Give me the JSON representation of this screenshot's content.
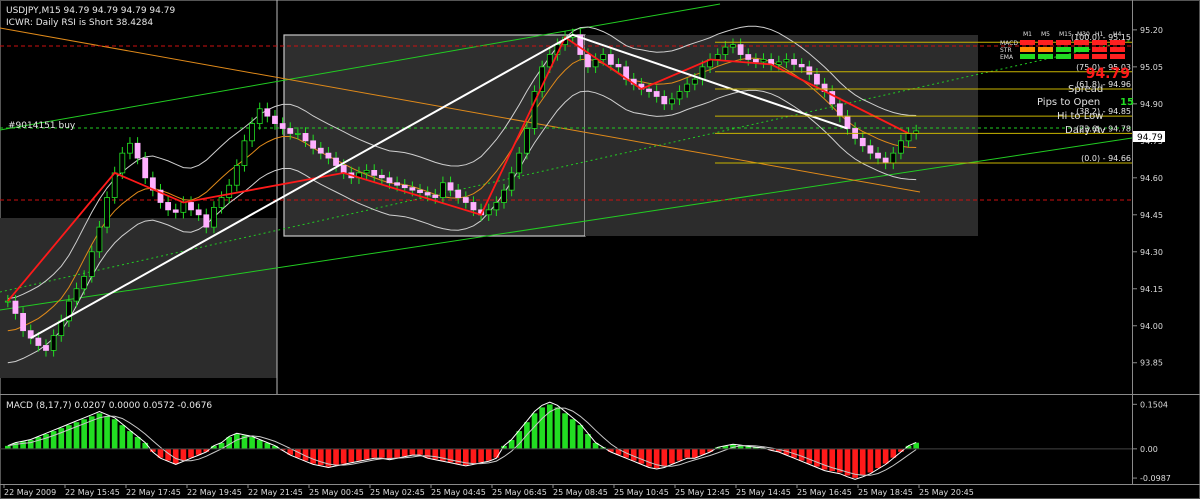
{
  "header": {
    "symbol_line": "USDJPY,M15  94.79 94.79 94.79 94.79",
    "rsi_line": "ICWR: Daily RSI is Short 38.4284",
    "order_label": "#9014151 buy"
  },
  "chart_data": [
    {
      "type": "candlestick",
      "title": "USDJPY,M15",
      "ylim": [
        93.78,
        95.24
      ],
      "y_ticks": [
        "95.20",
        "95.05",
        "94.90",
        "94.75",
        "94.60",
        "94.45",
        "94.30",
        "94.15",
        "94.00",
        "93.85"
      ],
      "y_tick_values": [
        95.2,
        95.05,
        94.9,
        94.75,
        94.6,
        94.45,
        94.3,
        94.15,
        94.0,
        93.85
      ],
      "x_ticks": [
        "22 May 2009",
        "22 May 15:45",
        "22 May 17:45",
        "22 May 19:45",
        "22 May 21:45",
        "25 May 00:45",
        "25 May 02:45",
        "25 May 04:45",
        "25 May 06:45",
        "25 May 08:45",
        "25 May 10:45",
        "25 May 12:45",
        "25 May 14:45",
        "25 May 16:45",
        "25 May 18:45",
        "25 May 20:45"
      ],
      "current_price": "94.79",
      "closes": [
        94.1,
        94.05,
        93.98,
        93.95,
        93.92,
        93.9,
        93.96,
        94.02,
        94.1,
        94.15,
        94.2,
        94.3,
        94.4,
        94.52,
        94.62,
        94.7,
        94.74,
        94.68,
        94.6,
        94.55,
        94.5,
        94.47,
        94.46,
        94.5,
        94.47,
        94.45,
        94.4,
        94.48,
        94.52,
        94.57,
        94.65,
        94.75,
        94.82,
        94.88,
        94.85,
        94.82,
        94.8,
        94.78,
        94.78,
        94.75,
        94.72,
        94.7,
        94.68,
        94.65,
        94.62,
        94.6,
        94.62,
        94.63,
        94.61,
        94.6,
        94.58,
        94.57,
        94.56,
        94.55,
        94.54,
        94.53,
        94.52,
        94.58,
        94.55,
        94.52,
        94.5,
        94.47,
        94.45,
        94.47,
        94.5,
        94.55,
        94.62,
        94.7,
        94.8,
        94.95,
        95.05,
        95.1,
        95.14,
        95.17,
        95.18,
        95.1,
        95.05,
        95.08,
        95.1,
        95.06,
        95.05,
        95.0,
        94.98,
        94.96,
        94.95,
        94.93,
        94.9,
        94.92,
        94.95,
        94.98,
        95.0,
        95.05,
        95.08,
        95.1,
        95.13,
        95.14,
        95.1,
        95.08,
        95.07,
        95.08,
        95.06,
        95.07,
        95.08,
        95.06,
        95.05,
        95.02,
        94.98,
        94.95,
        94.9,
        94.85,
        94.8,
        94.76,
        94.73,
        94.7,
        94.68,
        94.66,
        94.7,
        94.75,
        94.78,
        94.79
      ],
      "fib_levels": [
        {
          "label": "(100.0) - 95.15",
          "value": 95.15
        },
        {
          "label": "(75.0) - 95.03",
          "value": 95.03
        },
        {
          "label": "(61.8) - 94.96",
          "value": 94.96
        },
        {
          "label": "(38.2) - 94.85",
          "value": 94.85
        },
        {
          "label": "(23.6) - 94.78",
          "value": 94.78
        },
        {
          "label": "(0.0) - 94.66",
          "value": 94.66
        }
      ],
      "info_box": {
        "big_number": "94.79",
        "spread_label": "Spread",
        "pips_label": "Pips to Open",
        "pips_value": "15",
        "hilo_label": "Hi to Low",
        "daily_label": "Daily Av"
      },
      "signal_panel": {
        "timeframes": [
          "M1",
          "M5",
          "M15",
          "M30",
          "H1",
          "H4"
        ],
        "rows": [
          "MACD",
          "STR",
          "EMA"
        ],
        "colors": [
          [
            "#ff2020",
            "#ff2020",
            "#ff2020",
            "#ff2020",
            "#ff2020",
            "#ff2020"
          ],
          [
            "#ff8c00",
            "#ff8c00",
            "#22dd22",
            "#22dd22",
            "#ff2020",
            "#ff2020"
          ],
          [
            "#22dd22",
            "#22dd22",
            "#22dd22",
            "#ff2020",
            "#ff2020",
            "#ff2020"
          ]
        ]
      }
    },
    {
      "type": "bar",
      "title": "MACD (8,17,7) 0.0207 0.0000 0.0572 -0.0676",
      "ylim": [
        -0.112,
        0.165
      ],
      "y_ticks": [
        "0.1504",
        "0.00",
        "-0.0987"
      ],
      "y_tick_values": [
        0.1504,
        0.0,
        -0.0987
      ],
      "values": [
        0.01,
        0.02,
        0.025,
        0.03,
        0.04,
        0.05,
        0.06,
        0.07,
        0.08,
        0.09,
        0.1,
        0.11,
        0.12,
        0.11,
        0.1,
        0.08,
        0.06,
        0.04,
        0.02,
        -0.01,
        -0.03,
        -0.04,
        -0.05,
        -0.04,
        -0.03,
        -0.02,
        -0.01,
        0.01,
        0.02,
        0.04,
        0.05,
        0.045,
        0.04,
        0.03,
        0.02,
        0.01,
        -0.005,
        -0.02,
        -0.03,
        -0.04,
        -0.05,
        -0.055,
        -0.06,
        -0.055,
        -0.05,
        -0.045,
        -0.04,
        -0.035,
        -0.03,
        -0.03,
        -0.035,
        -0.03,
        -0.025,
        -0.02,
        -0.02,
        -0.03,
        -0.035,
        -0.04,
        -0.045,
        -0.05,
        -0.055,
        -0.05,
        -0.045,
        -0.04,
        -0.03,
        0.01,
        0.03,
        0.06,
        0.09,
        0.12,
        0.14,
        0.15,
        0.14,
        0.12,
        0.1,
        0.08,
        0.05,
        0.02,
        0.005,
        -0.01,
        -0.02,
        -0.03,
        -0.04,
        -0.05,
        -0.06,
        -0.065,
        -0.06,
        -0.05,
        -0.04,
        -0.03,
        -0.03,
        -0.02,
        -0.01,
        0.005,
        0.01,
        0.015,
        0.012,
        0.008,
        0.005,
        0.003,
        -0.005,
        -0.01,
        -0.02,
        -0.03,
        -0.04,
        -0.05,
        -0.06,
        -0.07,
        -0.075,
        -0.08,
        -0.09,
        -0.098,
        -0.09,
        -0.08,
        -0.065,
        -0.05,
        -0.03,
        -0.01,
        0.01,
        0.0207
      ],
      "colors": {
        "up": "#22dd22",
        "down": "#ff1a1a"
      }
    }
  ]
}
